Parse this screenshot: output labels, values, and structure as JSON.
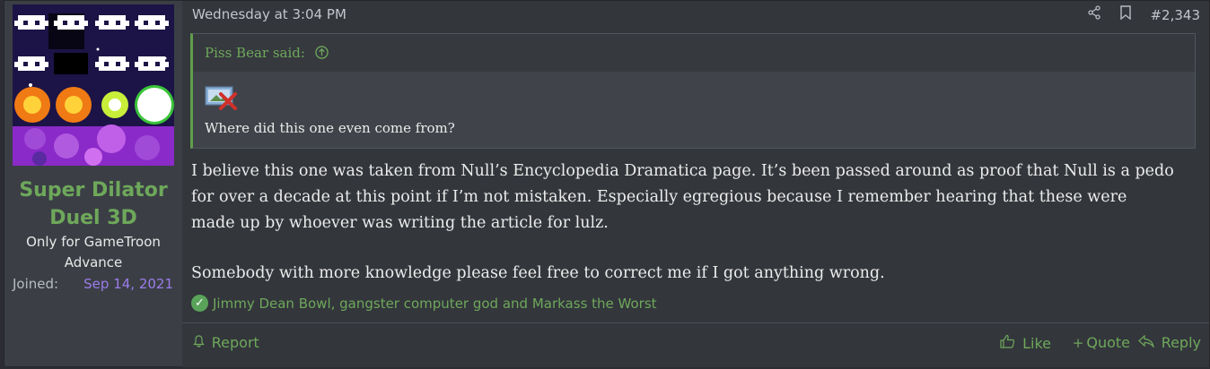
{
  "user": {
    "name": "Super Dilator Duel 3D",
    "name_line1": "Super Dilator",
    "name_line2": "Duel 3D",
    "title_line1": "Only for GameTroon",
    "title_line2": "Advance",
    "joined_label": "Joined:",
    "joined_date": "Sep 14, 2021",
    "avatar_icon": "space-invaders-avatar"
  },
  "post": {
    "date": "Wednesday at 3:04 PM",
    "number": "#2,343",
    "share_icon": "share-icon",
    "bookmark_icon": "bookmark-icon"
  },
  "quote": {
    "author_said": "Piss Bear said:",
    "jump_icon": "arrow-up-circle-icon",
    "image_icon": "broken-image-icon",
    "text": "Where did this one even come from?"
  },
  "body": {
    "line1": "I believe this one was taken from Null’s Encyclopedia Dramatica page. It’s been passed around as proof that Null is a pedo",
    "line2": "for over a decade at this point if I’m not mistaken. Especially egregious because I remember hearing that these were",
    "line3": "made up by whoever was writing the article for lulz.",
    "paragraph2": "Somebody with more knowledge please feel free to correct me if I got anything wrong."
  },
  "reactions": {
    "icon": "check-circle-icon",
    "text": "Jimmy Dean Bowl, gangster computer god and Markass the Worst"
  },
  "footer": {
    "report": "Report",
    "like": "Like",
    "quote": "Quote",
    "reply": "Reply"
  },
  "colors": {
    "accent_green": "#6ea85b",
    "joined_purple": "#9b7ce8",
    "background": "#33363b"
  }
}
